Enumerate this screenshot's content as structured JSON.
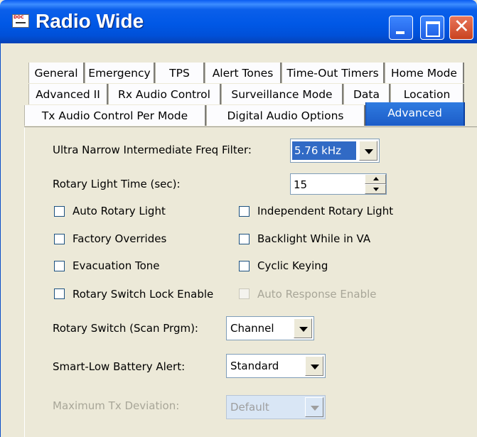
{
  "window": {
    "title": "Radio Wide",
    "app_icon": "doc-pen-icon",
    "app_icon_text": "DOC",
    "buttons": {
      "minimize": "minimize-icon",
      "maximize": "maximize-icon",
      "close": "✕"
    }
  },
  "tabs": {
    "row1": [
      "General",
      "Emergency",
      "TPS",
      "Alert Tones",
      "Time-Out Timers",
      "Home Mode"
    ],
    "row2": [
      "Advanced II",
      "Rx Audio Control",
      "Surveillance Mode",
      "Data",
      "Location"
    ],
    "row3": [
      "Tx Audio Control Per Mode",
      "Digital Audio Options",
      "Advanced"
    ],
    "active": "Advanced"
  },
  "panel": {
    "filter": {
      "label": "Ultra Narrow Intermediate Freq Filter:",
      "value": "5.76 kHz"
    },
    "rotary_light_time": {
      "label": "Rotary Light Time (sec):",
      "value": "15"
    },
    "checkboxes_left": [
      {
        "label": "Auto Rotary Light",
        "checked": false,
        "enabled": true
      },
      {
        "label": "Factory Overrides",
        "checked": false,
        "enabled": true
      },
      {
        "label": "Evacuation Tone",
        "checked": false,
        "enabled": true
      },
      {
        "label": "Rotary Switch Lock Enable",
        "checked": false,
        "enabled": true
      }
    ],
    "checkboxes_right": [
      {
        "label": "Independent Rotary Light",
        "checked": false,
        "enabled": true
      },
      {
        "label": "Backlight While in VA",
        "checked": false,
        "enabled": true
      },
      {
        "label": "Cyclic Keying",
        "checked": false,
        "enabled": true
      },
      {
        "label": "Auto Response Enable",
        "checked": false,
        "enabled": false
      }
    ],
    "rotary_switch": {
      "label": "Rotary Switch (Scan Prgm):",
      "value": "Channel"
    },
    "battery_alert": {
      "label": "Smart-Low Battery Alert:",
      "value": "Standard"
    },
    "max_tx_deviation": {
      "label": "Maximum Tx Deviation:",
      "value": "Default",
      "enabled": false
    }
  },
  "colors": {
    "titlebar": "#0058E6",
    "active_tab": "#2F7BE0",
    "panel_bg": "#ECE9D8",
    "selection": "#316AC5"
  }
}
